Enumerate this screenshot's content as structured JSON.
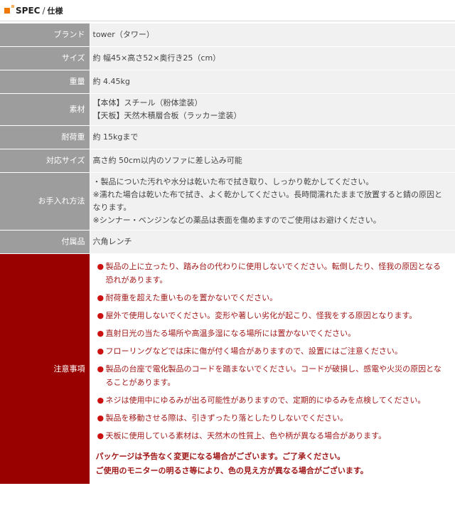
{
  "header": {
    "title_en": "SPEC",
    "separator": "/",
    "title_ja": "仕様"
  },
  "colors": {
    "label_bg": "#9d9d9d",
    "value_bg": "#f1f1f1",
    "warning_label_bg": "#990000",
    "warning_text": "#a01818",
    "accent": "#f07800"
  },
  "specs": [
    {
      "label": "ブランド",
      "lines": [
        "tower（タワー）"
      ]
    },
    {
      "label": "サイズ",
      "lines": [
        "約 幅45×高さ52×奥行き25（cm）"
      ]
    },
    {
      "label": "重量",
      "lines": [
        "約 4.45kg"
      ]
    },
    {
      "label": "素材",
      "lines": [
        "【本体】スチール（粉体塗装）",
        "【天板】天然木積層合板（ラッカー塗装）"
      ]
    },
    {
      "label": "耐荷重",
      "lines": [
        "約 15kgまで"
      ]
    },
    {
      "label": "対応サイズ",
      "lines": [
        "高さ約 50cm以内のソファに差し込み可能"
      ]
    },
    {
      "label": "お手入れ方法",
      "lines": [
        "・製品についた汚れや水分は乾いた布で拭き取り、しっかり乾かしてください。",
        "※濡れた場合は乾いた布で拭き、よく乾かしてください。長時間濡れたままで放置すると錆の原因となります。",
        "※シンナー・ベンジンなどの薬品は表面を傷めますのでご使用はお避けください。"
      ]
    },
    {
      "label": "付属品",
      "lines": [
        "六角レンチ"
      ]
    }
  ],
  "cautions": {
    "label": "注意事項",
    "bullet": "●",
    "items": [
      "製品の上に立ったり、踏み台の代わりに使用しないでください。転倒したり、怪我の原因となる恐れがあります。",
      "耐荷重を超えた重いものを置かないでください。",
      "屋外で使用しないでください。変形や著しい劣化が起こり、怪我をする原因となります。",
      "直射日光の当たる場所や高温多湿になる場所には置かないでください。",
      "フローリングなどでは床に傷が付く場合がありますので、設置にはご注意ください。",
      "製品の台座で電化製品のコードを踏まないでください。コードが破損し、感電や火災の原因となることがあります。",
      "ネジは使用中にゆるみが出る可能性がありますので、定期的にゆるみを点検してください。",
      "製品を移動させる際は、引きずったり落としたりしないでください。",
      "天板に使用している素材は、天然木の性質上、色や柄が異なる場合があります。"
    ],
    "notice_1": "パッケージは予告なく変更になる場合がございます。ご了承ください。",
    "notice_2": "ご使用のモニターの明るさ等により、色の見え方が異なる場合がございます。"
  }
}
